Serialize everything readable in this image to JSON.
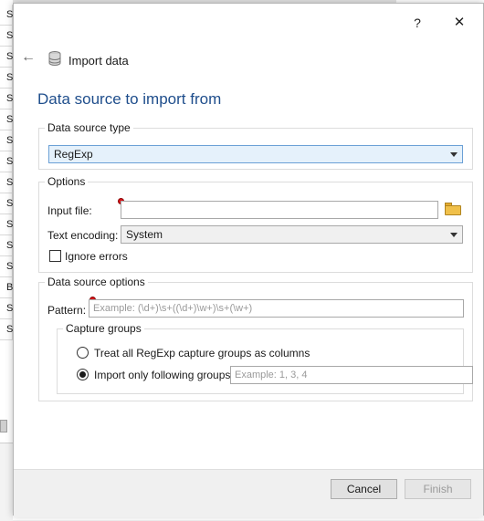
{
  "background": {
    "column_cells": [
      "S",
      "S",
      "S",
      "S",
      "S",
      "S",
      "S",
      "S",
      "S",
      "S",
      "S",
      "S",
      "S",
      "B",
      "S",
      "S"
    ]
  },
  "window": {
    "help_label": "?",
    "close_label": "✕"
  },
  "header": {
    "back_icon": "back-arrow-icon",
    "icon": "database-icon",
    "title": "Import data"
  },
  "page": {
    "title": "Data source to import from"
  },
  "data_source_type": {
    "legend": "Data source type",
    "selected": "RegExp"
  },
  "options": {
    "legend": "Options",
    "input_file_label": "Input file:",
    "input_file_value": "",
    "text_encoding_label": "Text encoding:",
    "text_encoding_value": "System",
    "ignore_errors_label": "Ignore errors",
    "ignore_errors_checked": false
  },
  "data_source_options": {
    "legend": "Data source options",
    "pattern_label": "Pattern:",
    "pattern_placeholder": "Example: (\\d+)\\s+((\\d+)\\w+)\\s+(\\w+)",
    "capture_groups": {
      "legend": "Capture groups",
      "option_all": "Treat all RegExp capture groups as columns",
      "option_only": "Import only following groups:",
      "selected": "option_only",
      "groups_placeholder": "Example: 1, 3, 4"
    }
  },
  "footer": {
    "cancel_label": "Cancel",
    "finish_label": "Finish",
    "finish_enabled": false
  },
  "colors": {
    "title_blue": "#1f4e8c",
    "error_red": "#d9141b",
    "focus_border": "#6ba0d6"
  }
}
